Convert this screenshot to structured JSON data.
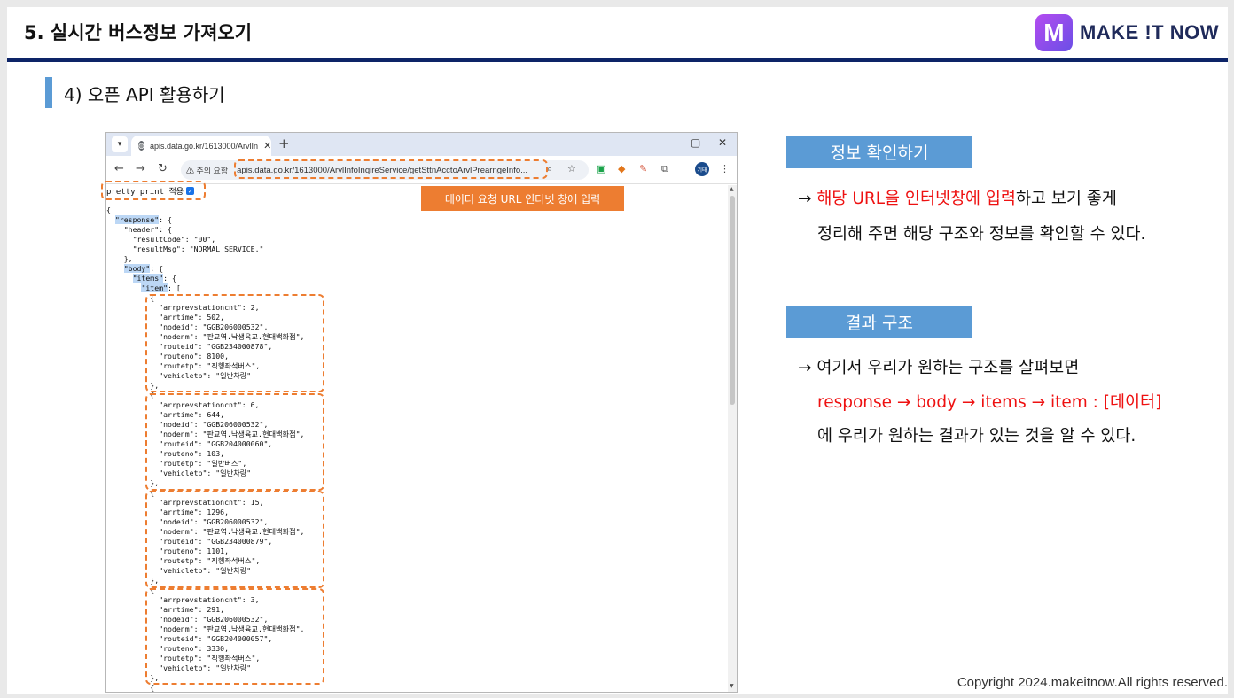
{
  "slide": {
    "title": "5. 실시간 버스정보 가져오기",
    "subtitle": "4) 오픈 API 활용하기",
    "logo_mark": "M",
    "logo_text": "MAKE !T NOW",
    "copyright": "Copyright 2024.makeitnow.All rights reserved."
  },
  "browser": {
    "tab_title": "apis.data.go.kr/1613000/ArvlIn",
    "tab_close": "✕",
    "new_tab": "+",
    "min": "—",
    "max": "▢",
    "close": "✕",
    "back": "←",
    "forward": "→",
    "reload": "↻",
    "security_warning": "⚠ 주의 요함",
    "url": "apis.data.go.kr/1613000/ArvlInfoInqireService/getSttnAcctoArvlPrearngeInfo...",
    "avatar": "기태",
    "pretty_print_label": "pretty print 적용"
  },
  "json_lines": [
    "{",
    "  \"response\": {",
    "    \"header\": {",
    "      \"resultCode\": \"00\",",
    "      \"resultMsg\": \"NORMAL SERVICE.\"",
    "    },",
    "    \"body\": {",
    "      \"items\": {",
    "        \"item\": [",
    "          {",
    "            \"arrprevstationcnt\": 2,",
    "            \"arrtime\": 502,",
    "            \"nodeid\": \"GGB206000532\",",
    "            \"nodenm\": \"판교역.낙생육교.현대백화점\",",
    "            \"routeid\": \"GGB234000878\",",
    "            \"routeno\": 8100,",
    "            \"routetp\": \"직행좌석버스\",",
    "            \"vehicletp\": \"일반차량\"",
    "          },",
    "          {",
    "            \"arrprevstationcnt\": 6,",
    "            \"arrtime\": 644,",
    "            \"nodeid\": \"GGB206000532\",",
    "            \"nodenm\": \"판교역.낙생육교.현대백화점\",",
    "            \"routeid\": \"GGB204000060\",",
    "            \"routeno\": 103,",
    "            \"routetp\": \"일반버스\",",
    "            \"vehicletp\": \"일반차량\"",
    "          },",
    "          {",
    "            \"arrprevstationcnt\": 15,",
    "            \"arrtime\": 1296,",
    "            \"nodeid\": \"GGB206000532\",",
    "            \"nodenm\": \"판교역.낙생육교.현대백화점\",",
    "            \"routeid\": \"GGB234000879\",",
    "            \"routeno\": 1101,",
    "            \"routetp\": \"직행좌석버스\",",
    "            \"vehicletp\": \"일반차량\"",
    "          },",
    "          {",
    "            \"arrprevstationcnt\": 3,",
    "            \"arrtime\": 291,",
    "            \"nodeid\": \"GGB206000532\",",
    "            \"nodenm\": \"판교역.낙생육교.현대백화점\",",
    "            \"routeid\": \"GGB204000057\",",
    "            \"routeno\": 3330,",
    "            \"routetp\": \"직행좌석버스\",",
    "            \"vehicletp\": \"일반차량\"",
    "          },",
    "          {"
  ],
  "callout": "데이터 요청 URL 인터넷 창에 입력",
  "section1": {
    "heading": "정보 확인하기",
    "arrow": "→",
    "red_part": "해당 URL을 인터넷창에 입력",
    "rest_part": "하고 보기 좋게",
    "line2": "정리해 주면 해당 구조와 정보를 확인할 수 있다."
  },
  "section2": {
    "heading": "결과 구조",
    "line1": "→ 여기서 우리가 원하는 구조를 살펴보면",
    "line2": "response → body → items → item : [데이터]",
    "line3": "에 우리가 원하는 결과가 있는 것을 알 수 있다."
  },
  "colors": {
    "accent_blue": "#5b9bd5",
    "navy_rule": "#0d2467",
    "orange": "#ed7d31",
    "red": "#ee1111"
  }
}
